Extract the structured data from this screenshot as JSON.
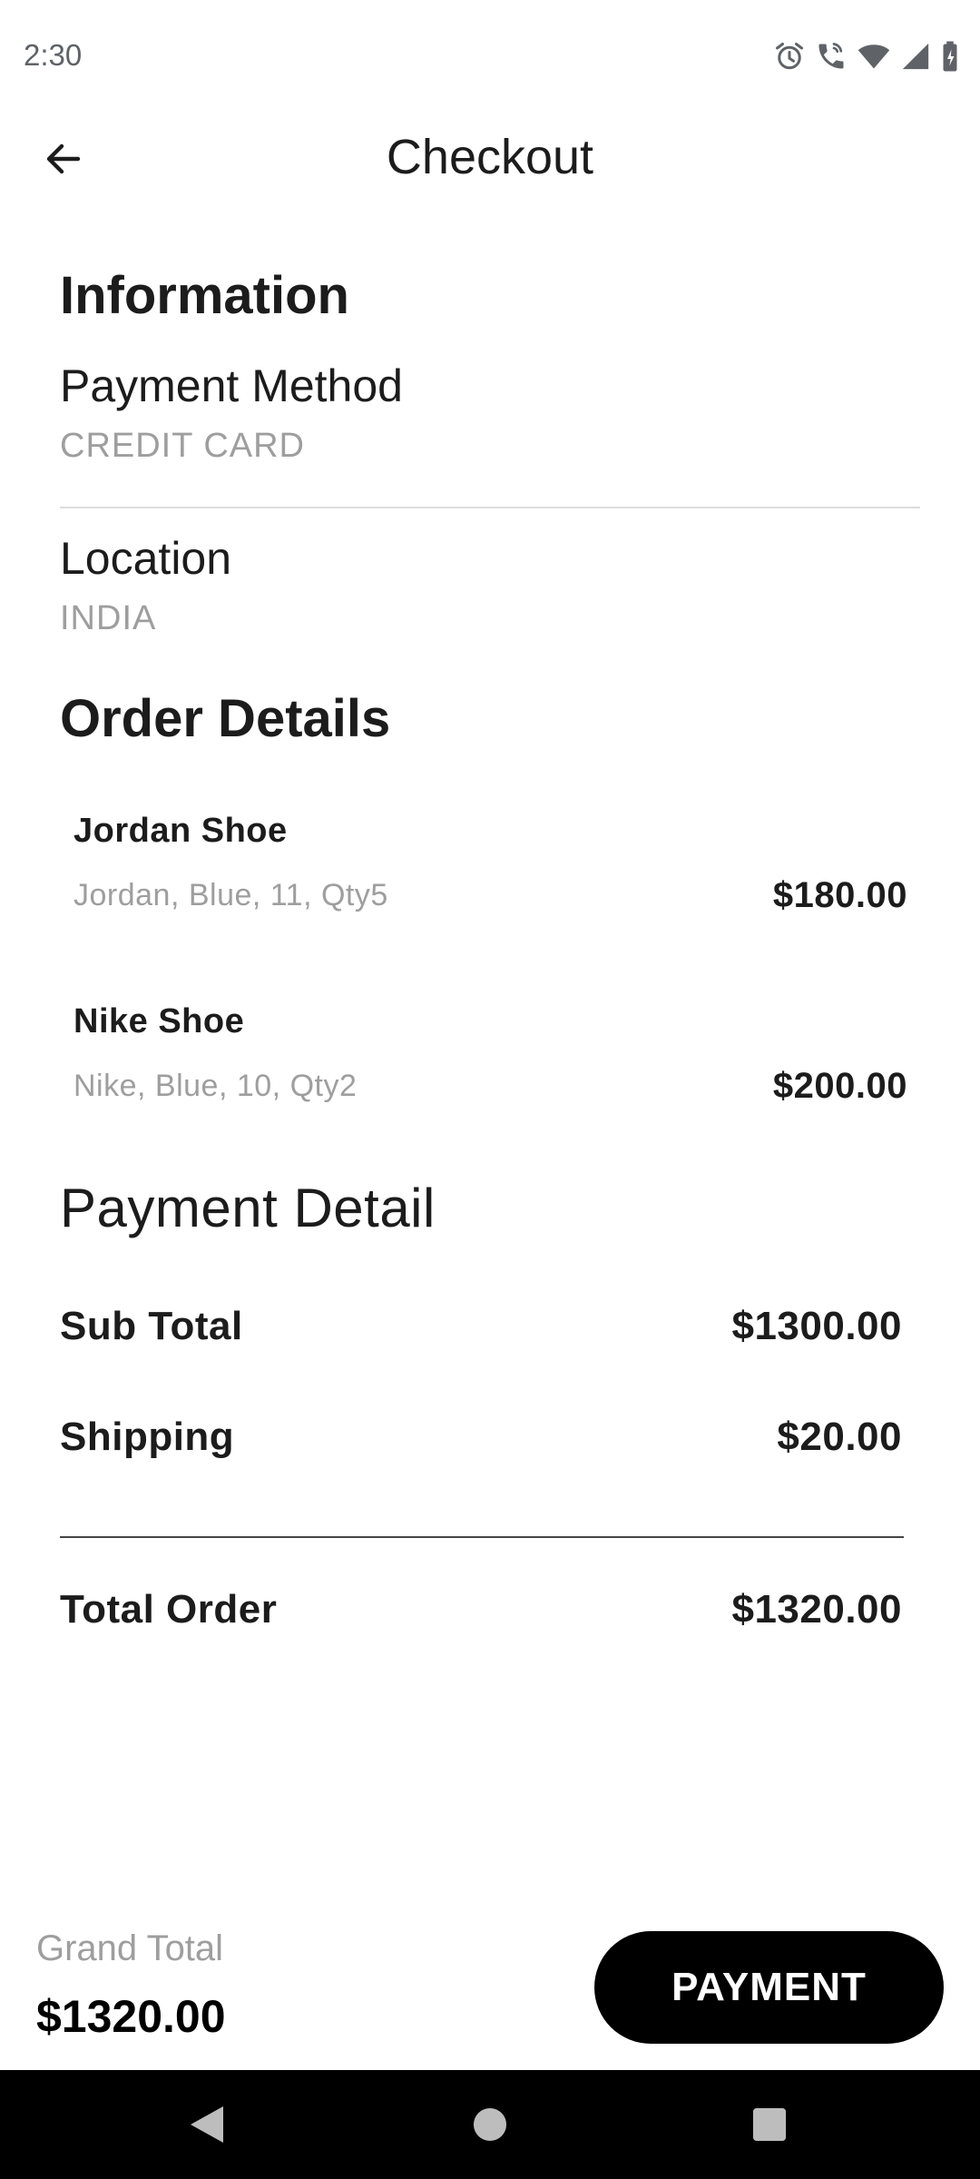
{
  "status_bar": {
    "time": "2:30",
    "icons": [
      "alarm-icon",
      "wifi-calling-icon",
      "wifi-icon",
      "signal-icon",
      "battery-charging-icon"
    ]
  },
  "app_bar": {
    "title": "Checkout",
    "back_icon": "arrow-back-icon"
  },
  "information": {
    "heading": "Information",
    "payment_method_label": "Payment Method",
    "payment_method_value": "CREDIT CARD",
    "location_label": "Location",
    "location_value": "INDIA"
  },
  "order_details": {
    "heading": "Order Details",
    "items": [
      {
        "name": "Jordan Shoe",
        "description": "Jordan, Blue, 11, Qty5",
        "price": "$180.00"
      },
      {
        "name": "Nike Shoe",
        "description": "Nike, Blue, 10, Qty2",
        "price": "$200.00"
      }
    ]
  },
  "payment_detail": {
    "heading": "Payment Detail",
    "subtotal_label": "Sub Total",
    "subtotal_value": "$1300.00",
    "shipping_label": "Shipping",
    "shipping_value": "$20.00",
    "total_label": "Total Order",
    "total_value": "$1320.00"
  },
  "bottom_bar": {
    "grand_total_label": "Grand Total",
    "grand_total_value": "$1320.00",
    "payment_button_label": "PAYMENT"
  },
  "nav_bar": {
    "buttons": [
      "back-triangle-icon",
      "home-circle-icon",
      "recents-square-icon"
    ]
  },
  "colors": {
    "primary": "#000000",
    "text": "#1c1c1c",
    "muted": "#9e9e9e",
    "background": "#ffffff"
  }
}
